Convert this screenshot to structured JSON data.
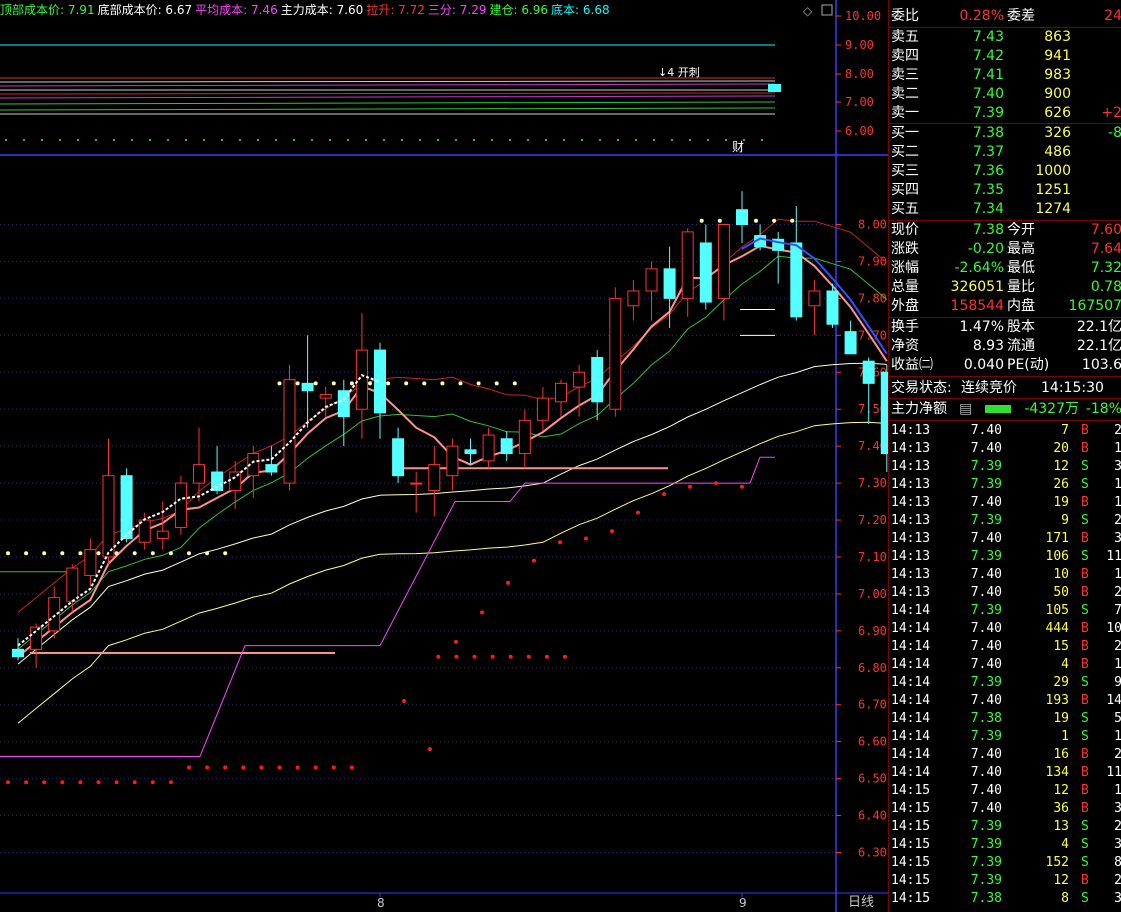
{
  "legend": [
    {
      "label": "顶部成本价:",
      "value": "7.91",
      "color": "#30ff30"
    },
    {
      "label": "底部成本价:",
      "value": "6.67",
      "color": "#ffffff"
    },
    {
      "label": "平均成本:",
      "value": "7.46",
      "color": "#ff40ff"
    },
    {
      "label": "主力成本:",
      "value": "7.60",
      "color": "#ffffff"
    },
    {
      "label": "拉升:",
      "value": "7.72",
      "color": "#ff3030"
    },
    {
      "label": "三分:",
      "value": "7.29",
      "color": "#ff40ff"
    },
    {
      "label": "建仓:",
      "value": "6.96",
      "color": "#30ff30"
    },
    {
      "label": "底本:",
      "value": "6.68",
      "color": "#00ffff"
    }
  ],
  "icons": [
    "diamond-icon",
    "maximize-icon"
  ],
  "top_axis": [
    "10.00",
    "9.00",
    "8.00",
    "7.00",
    "6.00"
  ],
  "top_annotations": {
    "signal": "↓4 开刺",
    "finance": "财"
  },
  "bottom_tag": "日线",
  "chart_data": {
    "type": "candlestick",
    "ylim": [
      6.25,
      8.15
    ],
    "yticks": [
      "8.00",
      "7.90",
      "7.80",
      "7.70",
      "7.60",
      "7.50",
      "7.40",
      "7.30",
      "7.20",
      "7.10",
      "7.00",
      "6.90",
      "6.80",
      "6.70",
      "6.60",
      "6.50",
      "6.40",
      "6.30"
    ],
    "xticks": [
      {
        "label": "8",
        "index": 20
      },
      {
        "label": "9",
        "index": 40
      }
    ],
    "candles": [
      {
        "o": 6.85,
        "h": 6.88,
        "l": 6.82,
        "c": 6.83
      },
      {
        "o": 6.85,
        "h": 6.92,
        "l": 6.8,
        "c": 6.91
      },
      {
        "o": 6.9,
        "h": 7.02,
        "l": 6.88,
        "c": 6.99
      },
      {
        "o": 6.98,
        "h": 7.08,
        "l": 6.95,
        "c": 7.07
      },
      {
        "o": 7.05,
        "h": 7.15,
        "l": 7.02,
        "c": 7.12
      },
      {
        "o": 7.1,
        "h": 7.42,
        "l": 7.08,
        "c": 7.32
      },
      {
        "o": 7.32,
        "h": 7.34,
        "l": 7.14,
        "c": 7.15
      },
      {
        "o": 7.14,
        "h": 7.22,
        "l": 7.12,
        "c": 7.2
      },
      {
        "o": 7.15,
        "h": 7.25,
        "l": 7.12,
        "c": 7.17
      },
      {
        "o": 7.18,
        "h": 7.32,
        "l": 7.16,
        "c": 7.3
      },
      {
        "o": 7.3,
        "h": 7.45,
        "l": 7.25,
        "c": 7.35
      },
      {
        "o": 7.33,
        "h": 7.4,
        "l": 7.27,
        "c": 7.28
      },
      {
        "o": 7.28,
        "h": 7.36,
        "l": 7.23,
        "c": 7.33
      },
      {
        "o": 7.32,
        "h": 7.4,
        "l": 7.26,
        "c": 7.38
      },
      {
        "o": 7.35,
        "h": 7.4,
        "l": 7.32,
        "c": 7.33
      },
      {
        "o": 7.3,
        "h": 7.62,
        "l": 7.28,
        "c": 7.58
      },
      {
        "o": 7.57,
        "h": 7.7,
        "l": 7.45,
        "c": 7.55
      },
      {
        "o": 7.53,
        "h": 7.56,
        "l": 7.48,
        "c": 7.54
      },
      {
        "o": 7.55,
        "h": 7.58,
        "l": 7.4,
        "c": 7.48
      },
      {
        "o": 7.5,
        "h": 7.76,
        "l": 7.42,
        "c": 7.66
      },
      {
        "o": 7.66,
        "h": 7.68,
        "l": 7.42,
        "c": 7.49
      },
      {
        "o": 7.42,
        "h": 7.45,
        "l": 7.3,
        "c": 7.32
      },
      {
        "o": 7.3,
        "h": 7.33,
        "l": 7.22,
        "c": 7.3
      },
      {
        "o": 7.28,
        "h": 7.4,
        "l": 7.21,
        "c": 7.35
      },
      {
        "o": 7.32,
        "h": 7.42,
        "l": 7.28,
        "c": 7.4
      },
      {
        "o": 7.39,
        "h": 7.42,
        "l": 7.35,
        "c": 7.38
      },
      {
        "o": 7.36,
        "h": 7.45,
        "l": 7.34,
        "c": 7.43
      },
      {
        "o": 7.42,
        "h": 7.44,
        "l": 7.36,
        "c": 7.38
      },
      {
        "o": 7.38,
        "h": 7.5,
        "l": 7.34,
        "c": 7.47
      },
      {
        "o": 7.47,
        "h": 7.56,
        "l": 7.44,
        "c": 7.53
      },
      {
        "o": 7.52,
        "h": 7.58,
        "l": 7.48,
        "c": 7.57
      },
      {
        "o": 7.56,
        "h": 7.62,
        "l": 7.48,
        "c": 7.6
      },
      {
        "o": 7.64,
        "h": 7.66,
        "l": 7.47,
        "c": 7.52
      },
      {
        "o": 7.5,
        "h": 7.83,
        "l": 7.48,
        "c": 7.8
      },
      {
        "o": 7.78,
        "h": 7.85,
        "l": 7.74,
        "c": 7.82
      },
      {
        "o": 7.82,
        "h": 7.9,
        "l": 7.74,
        "c": 7.88
      },
      {
        "o": 7.88,
        "h": 7.94,
        "l": 7.72,
        "c": 7.8
      },
      {
        "o": 7.8,
        "h": 7.99,
        "l": 7.75,
        "c": 7.98
      },
      {
        "o": 7.95,
        "h": 8.0,
        "l": 7.77,
        "c": 7.79
      },
      {
        "o": 7.8,
        "h": 8.0,
        "l": 7.74,
        "c": 8.0
      },
      {
        "o": 8.04,
        "h": 8.09,
        "l": 7.95,
        "c": 8.0
      },
      {
        "o": 7.97,
        "h": 8.0,
        "l": 7.93,
        "c": 7.94
      },
      {
        "o": 7.96,
        "h": 7.98,
        "l": 7.84,
        "c": 7.93
      },
      {
        "o": 7.95,
        "h": 8.05,
        "l": 7.74,
        "c": 7.75
      },
      {
        "o": 7.78,
        "h": 7.85,
        "l": 7.7,
        "c": 7.82
      },
      {
        "o": 7.82,
        "h": 7.84,
        "l": 7.72,
        "c": 7.73
      },
      {
        "o": 7.71,
        "h": 7.74,
        "l": 7.65,
        "c": 7.65
      },
      {
        "o": 7.63,
        "h": 7.64,
        "l": 7.46,
        "c": 7.57
      },
      {
        "o": 7.6,
        "h": 7.62,
        "l": 7.33,
        "c": 7.38
      }
    ]
  },
  "depth": {
    "header": {
      "label": "委比",
      "value": "0.28%",
      "label2": "委差",
      "value2": "24"
    },
    "sell": [
      {
        "label": "卖五",
        "price": "7.43",
        "vol": "863",
        "chg": ""
      },
      {
        "label": "卖四",
        "price": "7.42",
        "vol": "941",
        "chg": ""
      },
      {
        "label": "卖三",
        "price": "7.41",
        "vol": "983",
        "chg": ""
      },
      {
        "label": "卖二",
        "price": "7.40",
        "vol": "900",
        "chg": ""
      },
      {
        "label": "卖一",
        "price": "7.39",
        "vol": "626",
        "chg": "+2"
      }
    ],
    "buy": [
      {
        "label": "买一",
        "price": "7.38",
        "vol": "326",
        "chg": "-8"
      },
      {
        "label": "买二",
        "price": "7.37",
        "vol": "486",
        "chg": ""
      },
      {
        "label": "买三",
        "price": "7.36",
        "vol": "1000",
        "chg": ""
      },
      {
        "label": "买四",
        "price": "7.35",
        "vol": "1251",
        "chg": ""
      },
      {
        "label": "买五",
        "price": "7.34",
        "vol": "1274",
        "chg": ""
      }
    ]
  },
  "quote": [
    {
      "l": "现价",
      "v": "7.38",
      "vc": "#30ff30",
      "l2": "今开",
      "v2": "7.60",
      "v2c": "#ff3030"
    },
    {
      "l": "涨跌",
      "v": "-0.20",
      "vc": "#30ff30",
      "l2": "最高",
      "v2": "7.64",
      "v2c": "#ff3030"
    },
    {
      "l": "涨幅",
      "v": "-2.64%",
      "vc": "#30ff30",
      "l2": "最低",
      "v2": "7.32",
      "v2c": "#30ff30"
    },
    {
      "l": "总量",
      "v": "326051",
      "vc": "#ffff40",
      "l2": "量比",
      "v2": "0.78",
      "v2c": "#30ff30"
    },
    {
      "l": "外盘",
      "v": "158544",
      "vc": "#ff3030",
      "l2": "内盘",
      "v2": "167507",
      "v2c": "#30ff30"
    }
  ],
  "quote2": [
    {
      "l": "换手",
      "v": "1.47%",
      "vc": "#ffffff",
      "l2": "股本",
      "v2": "22.1亿",
      "v2c": "#ffffff"
    },
    {
      "l": "净资",
      "v": "8.93",
      "vc": "#ffffff",
      "l2": "流通",
      "v2": "22.1亿",
      "v2c": "#ffffff"
    },
    {
      "l": "收益㈡",
      "v": "0.040",
      "vc": "#ffffff",
      "l2": "PE(动)",
      "v2": "103.6",
      "v2c": "#ffffff"
    }
  ],
  "trade_status": {
    "label": "交易状态:",
    "status": "连续竞价",
    "time": "14:15:30"
  },
  "main_flow": {
    "label": "主力净额",
    "value": "-4327万",
    "pct": "-18%"
  },
  "ticks": [
    {
      "t": "14:13",
      "p": "7.40",
      "v": "7",
      "s": "B",
      "n": "2"
    },
    {
      "t": "14:13",
      "p": "7.40",
      "v": "20",
      "s": "B",
      "n": "1"
    },
    {
      "t": "14:13",
      "p": "7.39",
      "v": "12",
      "s": "S",
      "n": "3"
    },
    {
      "t": "14:13",
      "p": "7.39",
      "v": "26",
      "s": "S",
      "n": "1"
    },
    {
      "t": "14:13",
      "p": "7.40",
      "v": "19",
      "s": "B",
      "n": "1"
    },
    {
      "t": "14:13",
      "p": "7.39",
      "v": "9",
      "s": "S",
      "n": "2"
    },
    {
      "t": "14:13",
      "p": "7.40",
      "v": "171",
      "s": "B",
      "n": "3"
    },
    {
      "t": "14:13",
      "p": "7.39",
      "v": "106",
      "s": "S",
      "n": "11"
    },
    {
      "t": "14:13",
      "p": "7.40",
      "v": "10",
      "s": "B",
      "n": "1"
    },
    {
      "t": "14:13",
      "p": "7.40",
      "v": "50",
      "s": "B",
      "n": "2"
    },
    {
      "t": "14:14",
      "p": "7.39",
      "v": "105",
      "s": "S",
      "n": "7"
    },
    {
      "t": "14:14",
      "p": "7.40",
      "v": "444",
      "s": "B",
      "n": "10"
    },
    {
      "t": "14:14",
      "p": "7.40",
      "v": "15",
      "s": "B",
      "n": "2"
    },
    {
      "t": "14:14",
      "p": "7.40",
      "v": "4",
      "s": "B",
      "n": "1"
    },
    {
      "t": "14:14",
      "p": "7.39",
      "v": "29",
      "s": "S",
      "n": "9"
    },
    {
      "t": "14:14",
      "p": "7.40",
      "v": "193",
      "s": "B",
      "n": "14"
    },
    {
      "t": "14:14",
      "p": "7.38",
      "v": "19",
      "s": "S",
      "n": "5"
    },
    {
      "t": "14:14",
      "p": "7.39",
      "v": "1",
      "s": "S",
      "n": "1"
    },
    {
      "t": "14:14",
      "p": "7.40",
      "v": "16",
      "s": "B",
      "n": "2"
    },
    {
      "t": "14:14",
      "p": "7.40",
      "v": "134",
      "s": "B",
      "n": "11"
    },
    {
      "t": "14:15",
      "p": "7.40",
      "v": "12",
      "s": "B",
      "n": "1"
    },
    {
      "t": "14:15",
      "p": "7.40",
      "v": "36",
      "s": "B",
      "n": "3"
    },
    {
      "t": "14:15",
      "p": "7.39",
      "v": "13",
      "s": "S",
      "n": "2"
    },
    {
      "t": "14:15",
      "p": "7.39",
      "v": "4",
      "s": "S",
      "n": "3"
    },
    {
      "t": "14:15",
      "p": "7.39",
      "v": "152",
      "s": "S",
      "n": "8"
    },
    {
      "t": "14:15",
      "p": "7.39",
      "v": "12",
      "s": "B",
      "n": "2"
    },
    {
      "t": "14:15",
      "p": "7.38",
      "v": "8",
      "s": "S",
      "n": "3"
    }
  ]
}
